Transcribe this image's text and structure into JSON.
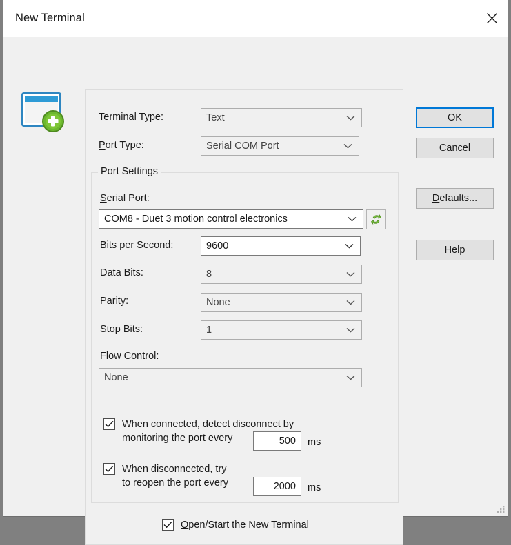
{
  "window": {
    "title": "New Terminal",
    "close_icon": "close-icon",
    "app_icon": "new-terminal-icon"
  },
  "form": {
    "terminal_type": {
      "label": "Terminal Type:",
      "accel": "T",
      "value": "Text",
      "enabled": false
    },
    "port_type": {
      "label": "Port Type:",
      "accel": "P",
      "value": "Serial COM Port",
      "enabled": false
    }
  },
  "port_settings": {
    "legend": "Port Settings",
    "serial_port": {
      "label": "Serial Port:",
      "accel": "S",
      "value": "COM8 - Duet 3 motion control electronics",
      "enabled": true
    },
    "refresh_icon": "refresh-icon",
    "bits_per_second": {
      "label": "Bits per Second:",
      "value": "9600",
      "enabled": true
    },
    "data_bits": {
      "label": "Data Bits:",
      "value": "8",
      "enabled": false
    },
    "parity": {
      "label": "Parity:",
      "value": "None",
      "enabled": false
    },
    "stop_bits": {
      "label": "Stop Bits:",
      "value": "1",
      "enabled": false
    },
    "flow_control": {
      "label": "Flow Control:",
      "value": "None",
      "enabled": false
    },
    "detect_disconnect": {
      "checked": true,
      "label": "When connected, detect disconnect by\nmonitoring the port every",
      "value": "500",
      "unit": "ms"
    },
    "reopen_port": {
      "checked": true,
      "label": "When disconnected, try\nto reopen the port every",
      "value": "2000",
      "unit": "ms"
    }
  },
  "open_start": {
    "checked": true,
    "label": "Open/Start the New Terminal",
    "accel": "O"
  },
  "buttons": {
    "ok": "OK",
    "cancel": "Cancel",
    "defaults": "Defaults...",
    "defaults_accel": "D",
    "help": "Help"
  },
  "colors": {
    "accent": "#0078d7",
    "dialog_bg": "#f0f0f0",
    "titlebar_bg": "#ffffff",
    "icon_blue": "#2e9bd6",
    "icon_green": "#6cb82e"
  }
}
